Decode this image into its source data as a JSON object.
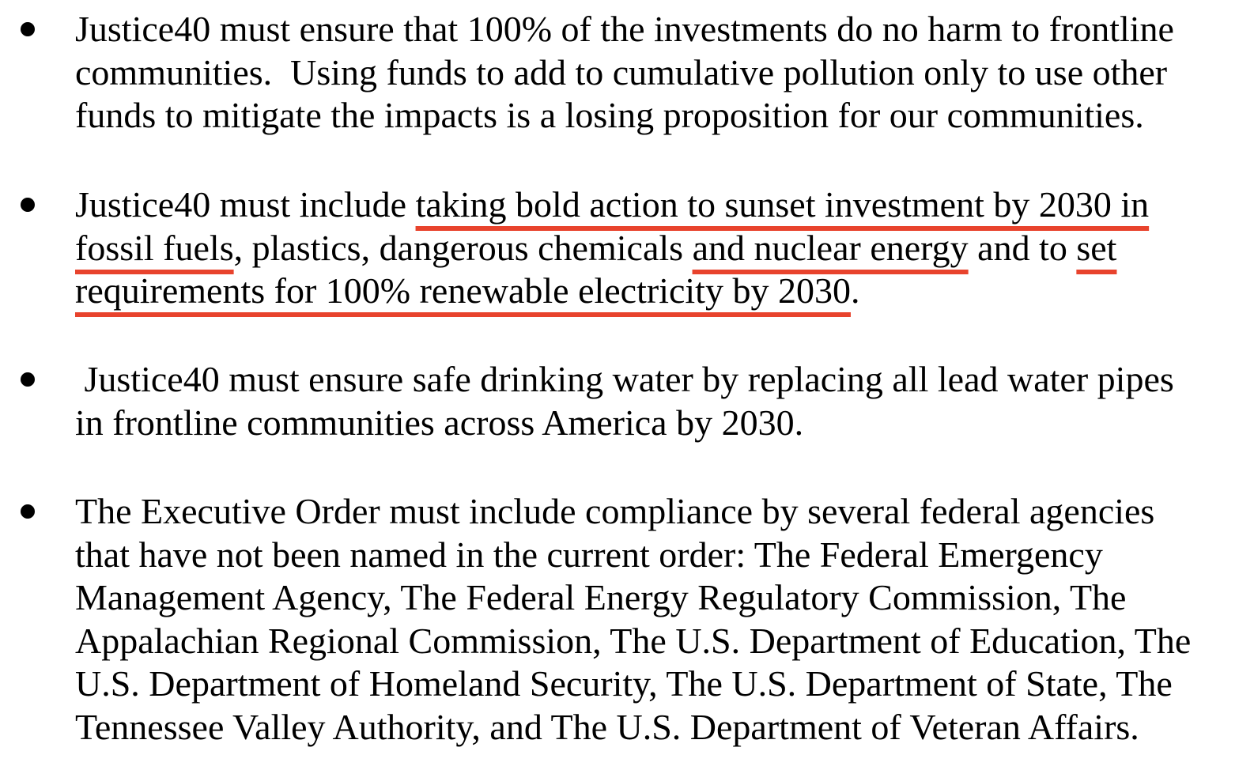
{
  "document": {
    "bullets": [
      {
        "lines": [
          "Justice40 must ensure that 100% of the investments do no harm to frontline",
          "communities.  Using funds to add to cumulative pollution only to use other",
          "funds to mitigate the impacts is a losing proposition for our communities."
        ]
      },
      {
        "line1": {
          "plain_a": "Justice40 must include ",
          "highlight_a": "taking bold action to sunset investment by 2030 in"
        },
        "line2": {
          "highlight_b": "fossil fuels",
          "plain_b": ", plastics, dangerous chemicals ",
          "highlight_c": "and nuclear energy",
          "plain_c": " and to ",
          "highlight_d": "set"
        },
        "line3": {
          "highlight_e": "requirements for 100% renewable electricity by 2030",
          "plain_d": "."
        },
        "highlight_color": "#e8432d"
      },
      {
        "lines": [
          " Justice40 must ensure safe drinking water by replacing all lead water pipes",
          "in frontline communities across America by 2030."
        ]
      },
      {
        "lines": [
          "The Executive Order must include compliance by several federal agencies",
          "that have not been named in the current order: The Federal Emergency",
          "Management Agency, The Federal Energy Regulatory Commission, The",
          "Appalachian Regional Commission, The U.S. Department of Education, The",
          "U.S. Department of Homeland Security, The U.S. Department of State, The",
          "Tennessee Valley Authority, and The U.S. Department of Veteran Affairs."
        ]
      }
    ]
  }
}
